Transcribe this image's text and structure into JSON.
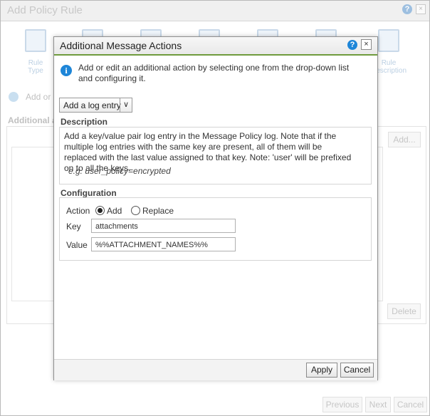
{
  "background": {
    "title": "Add Policy Rule",
    "help_label": "?",
    "close_label": "×",
    "steps": [
      {
        "label": "Rule\nType"
      },
      {
        "label": ""
      },
      {
        "label": ""
      },
      {
        "label": ""
      },
      {
        "label": ""
      },
      {
        "label": ""
      },
      {
        "label": "Rule\nDescription"
      }
    ],
    "add_or_text": "Add or e",
    "additional_label": "Additional a",
    "add_button": "Add...",
    "delete_button": "Delete",
    "previous_button": "Previous",
    "next_button": "Next",
    "cancel_button": "Cancel"
  },
  "modal": {
    "title": "Additional Message Actions",
    "help_label": "?",
    "close_label": "×",
    "info_icon_label": "i",
    "info_text": "Add or edit an additional action by selecting one from the drop-down list and configuring it.",
    "dropdown": {
      "selected": "Add a log entry",
      "arrow": "∨"
    },
    "description_heading": "Description",
    "description_text": "Add a key/value pair log entry in the Message Policy log. Note that if the multiple log entries with the same key are present, all of them will be replaced with the last value assigned to that key. Note: 'user' will be prefixed on to all the keys.",
    "example_text": "e.g. user_policy=encrypted",
    "configuration_heading": "Configuration",
    "action_label": "Action",
    "radio_add_label": "Add",
    "radio_replace_label": "Replace",
    "selected_action": "Add",
    "key_label": "Key",
    "key_value": "attachments",
    "value_label": "Value",
    "value_value": "%%ATTACHMENT_NAMES%%",
    "apply_button": "Apply",
    "cancel_button": "Cancel"
  }
}
